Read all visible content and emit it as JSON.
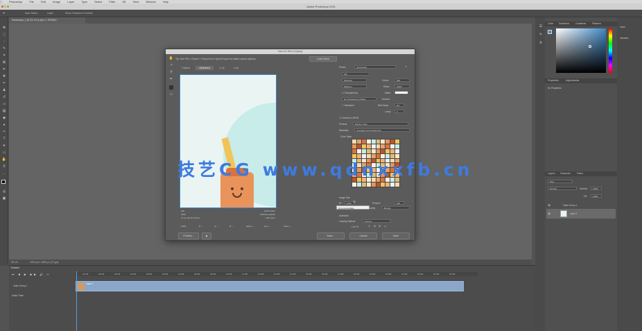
{
  "app": {
    "title": "Adobe Photoshop 2021",
    "document_tab": "Darkshape_2 @ 33.1% (Layer 1, RGB/8) *"
  },
  "menubar": {
    "items": [
      "Photoshop",
      "File",
      "Edit",
      "Image",
      "Layer",
      "Type",
      "Select",
      "Filter",
      "3D",
      "View",
      "Window",
      "Help"
    ]
  },
  "options_bar": {
    "items": [
      "Auto-Select:",
      "Layer",
      "Show Transform Controls"
    ]
  },
  "dialog": {
    "title": "Save for Web (Legacy)",
    "note": "Tip: Use File > Export > Export As or Quick Export for faster export options.",
    "learn_more": "Learn More",
    "tabs": [
      "Original",
      "Optimized",
      "2-Up",
      "4-Up"
    ],
    "active_tab": "Optimized",
    "image_info": {
      "format": "GIF",
      "size": "400K",
      "time": "74 sec @ 56.6 Kbps",
      "dither": "100% dither",
      "palette": "Selective palette",
      "colors": "128 colors"
    },
    "zoom_row": [
      "100%",
      "R: --",
      "G: --",
      "B: --",
      "Alpha: --",
      "Hex: --",
      "Index: --"
    ],
    "buttons": {
      "preview": "Preview...",
      "save": "Save...",
      "cancel": "Cancel",
      "done": "Done"
    },
    "settings": {
      "preset_label": "Preset:",
      "preset_value": "[Unnamed]",
      "format": "GIF",
      "reduction": "Selective",
      "colors_label": "Colors:",
      "colors_value": "256",
      "dither_algo": "Diffusion",
      "dither_label": "Dither:",
      "dither_value": "100%",
      "transparency": "Transparency",
      "matte_label": "Matte:",
      "trans_dither": "No Transparency Dither",
      "amount_label": "Amount:",
      "interlaced": "Interlaced",
      "web_snap_label": "Web Snap:",
      "web_snap_value": "0%",
      "lossy_label": "Lossy:",
      "lossy_value": "0",
      "convert_srgb": "Convert to sRGB",
      "preview_label": "Preview:",
      "preview_value": "Monitor Color",
      "metadata_label": "Metadata:",
      "metadata_value": "Copyright and Contact Info",
      "color_table_label": "Color Table",
      "image_size_label": "Image Size",
      "w_label": "W:",
      "w_value": "1920",
      "h_label": "H:",
      "h_value": "1080",
      "percent_label": "Percent:",
      "percent_value": "100",
      "quality_label": "Quality:",
      "quality_value": "Bicubic",
      "animation_label": "Animation",
      "looping_label": "Looping Options:",
      "looping_value": "Forever",
      "frame_counter": "1 of 74"
    },
    "tooltip": "Fit to percentage"
  },
  "watermark": "技艺CG www.qdnxxfb.cn",
  "right_panels": {
    "color_tabs": [
      "Color",
      "Swatches",
      "Gradients",
      "Patterns"
    ],
    "props_tabs": [
      "Properties",
      "Adjustments"
    ],
    "props_text": "No Properties",
    "layers_tabs": [
      "Layers",
      "Channels",
      "Paths"
    ],
    "kind_label": "Kind",
    "blend_mode": "Normal",
    "opacity_label": "Opacity:",
    "opacity_value": "100%",
    "fill_label": "Fill:",
    "fill_value": "100%",
    "group_name": "Video Group 1",
    "layer_name": "Layer 1",
    "far_right": [
      "Learn",
      "Libraries"
    ]
  },
  "timeline": {
    "title": "Timeline",
    "tracks": [
      "Video Group 1",
      "Audio Track"
    ],
    "clip_label": "Layer 1",
    "ruler_labels": [
      "01:00f",
      "02:00f",
      "03:00f",
      "04:00f",
      "05:00f",
      "06:00f",
      "07:00f",
      "08:00f",
      "09:00f",
      "10:00f",
      "11:00f",
      "12:00f",
      "13:00f",
      "14:00f",
      "15:00f",
      "16:00f",
      "17:00f",
      "18:00f",
      "19:00f",
      "20:00f",
      "21:00f",
      "22:00f",
      "23:00f",
      "24:00f"
    ]
  },
  "status": {
    "zoom": "33.1%",
    "doc_size": "1920 px x 1080 px (72 ppi)"
  }
}
